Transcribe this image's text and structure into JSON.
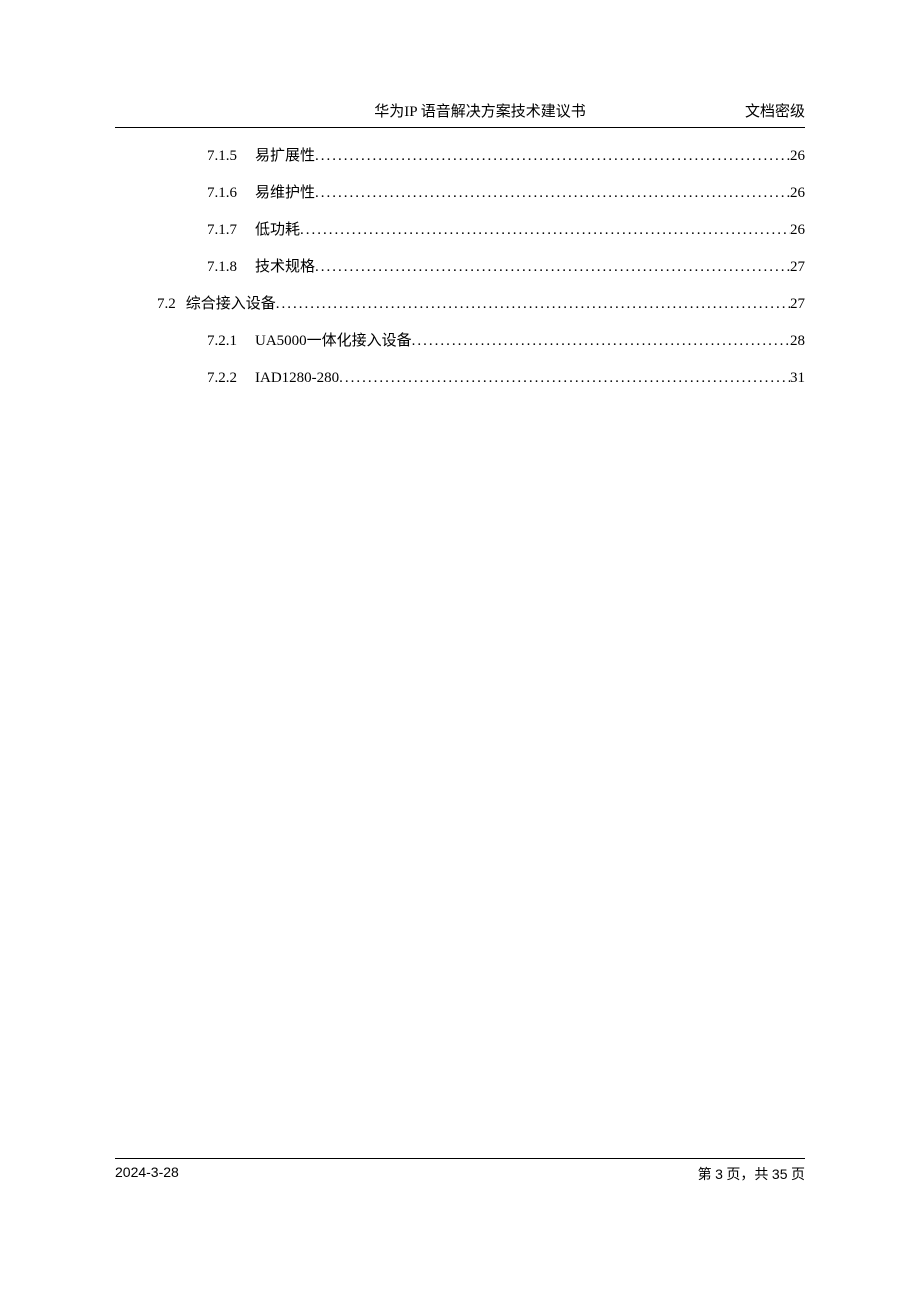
{
  "header": {
    "title": "华为IP 语音解决方案技术建议书",
    "classification": "文档密级"
  },
  "toc": {
    "items": [
      {
        "level": 3,
        "num": "7.1.5",
        "title": "易扩展性",
        "page": "26"
      },
      {
        "level": 3,
        "num": "7.1.6",
        "title": "易维护性",
        "page": "26"
      },
      {
        "level": 3,
        "num": "7.1.7",
        "title": "低功耗",
        "page": "26"
      },
      {
        "level": 3,
        "num": "7.1.8",
        "title": "技术规格",
        "page": "27"
      },
      {
        "level": 2,
        "num": "7.2",
        "title": "综合接入设备",
        "page": "27"
      },
      {
        "level": 3,
        "num": "7.2.1",
        "title": "UA5000一体化接入设备",
        "page": "28"
      },
      {
        "level": 3,
        "num": "7.2.2",
        "title": "IAD1280-280",
        "page": "31"
      }
    ]
  },
  "footer": {
    "date": "2024-3-28",
    "page_prefix": "第",
    "page_current": "3",
    "page_mid": "页，共",
    "page_total": "35",
    "page_suffix": "页"
  }
}
